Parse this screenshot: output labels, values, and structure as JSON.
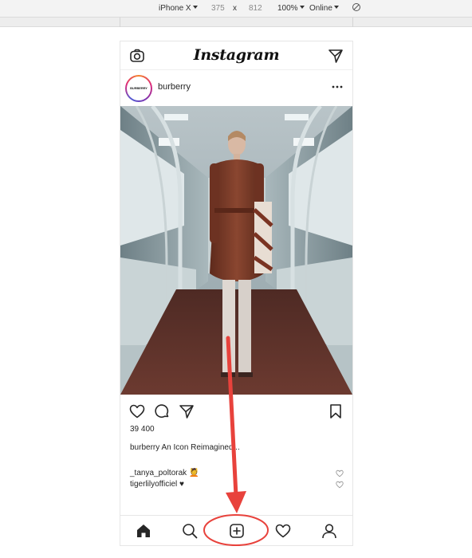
{
  "devtools": {
    "device": "iPhone X",
    "width": "375",
    "times": "x",
    "height": "812",
    "zoom": "100%",
    "network": "Online",
    "rotate_icon": "rotate-icon"
  },
  "app": {
    "logo": "Instagram",
    "icons": {
      "camera": "camera-icon",
      "direct": "send-icon"
    }
  },
  "post": {
    "avatar_text": "BURBERRY",
    "username": "burberry",
    "more_icon": "more-icon",
    "image_description_icon": "photo",
    "likes": "39 400",
    "caption": "burberry An Icon Reimagined...",
    "comments": [
      {
        "text": "_tanya_poltorak 💆"
      },
      {
        "text": "tigerlilyofficiel ♥"
      }
    ]
  },
  "bottom_nav": {
    "items": [
      "home-icon",
      "search-icon",
      "new-post-icon",
      "activity-icon",
      "profile-icon"
    ],
    "highlighted": "new-post-icon"
  },
  "colors": {
    "annotation": "#e8423c",
    "highlight_ring": "#e8423c"
  }
}
